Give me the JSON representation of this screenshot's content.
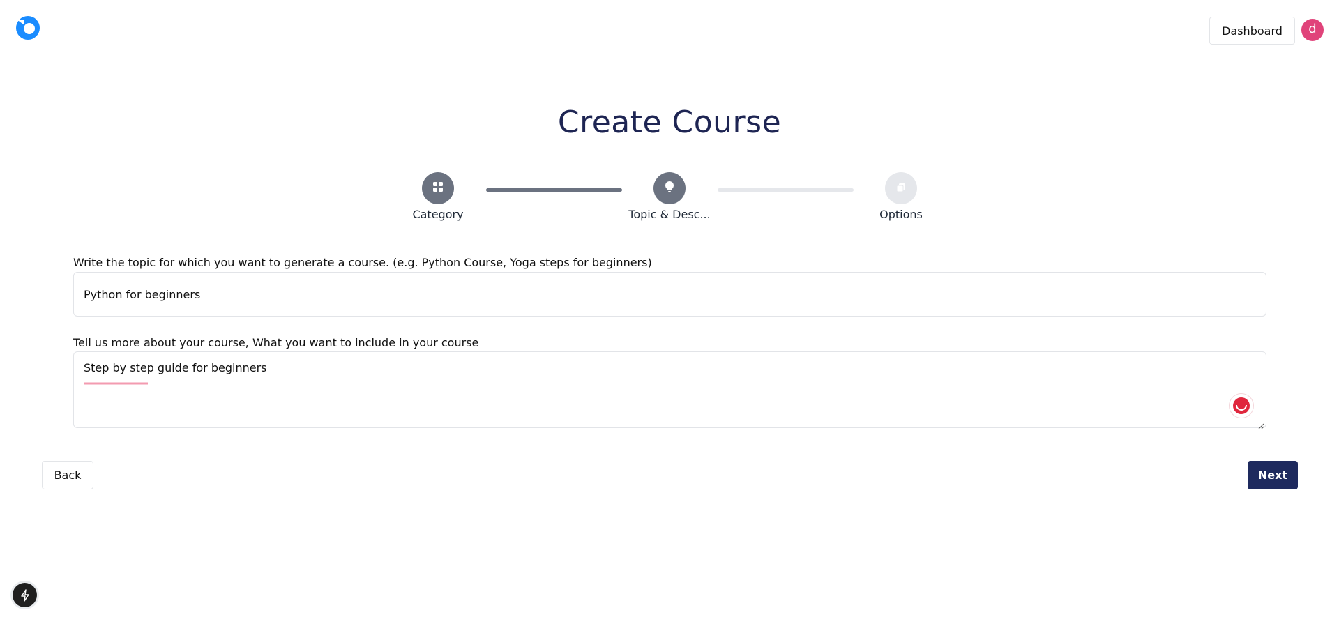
{
  "colors": {
    "brand": "#1a8cff",
    "title": "#1e2553",
    "primary_button": "#1e2a5e",
    "step_active": "#6b7280",
    "step_inactive": "#e5e7eb",
    "avatar": "#e0437a",
    "spell_underline": "#f39bb0",
    "grammar_badge": "#e0263d"
  },
  "header": {
    "logo_icon": "brand-logo-icon",
    "dashboard_label": "Dashboard",
    "avatar_initial": "d"
  },
  "page": {
    "title": "Create Course"
  },
  "stepper": {
    "progress_fraction": 0.5,
    "steps": [
      {
        "label": "Category",
        "icon": "grid-icon",
        "state": "completed"
      },
      {
        "label": "Topic & Desc...",
        "icon": "lightbulb-icon",
        "state": "active"
      },
      {
        "label": "Options",
        "icon": "clipboard-icon",
        "state": "pending"
      }
    ]
  },
  "form": {
    "topic_label": "Write the topic for which you want to generate a course. (e.g. Python Course, Yoga steps for beginners)",
    "topic_value": "Python for beginners",
    "description_label": "Tell us more about your course, What you want to include in your course",
    "description_value": "Step by step guide for beginners"
  },
  "actions": {
    "back_label": "Back",
    "next_label": "Next"
  },
  "floating": {
    "bolt_icon": "lightning-bolt-icon"
  }
}
